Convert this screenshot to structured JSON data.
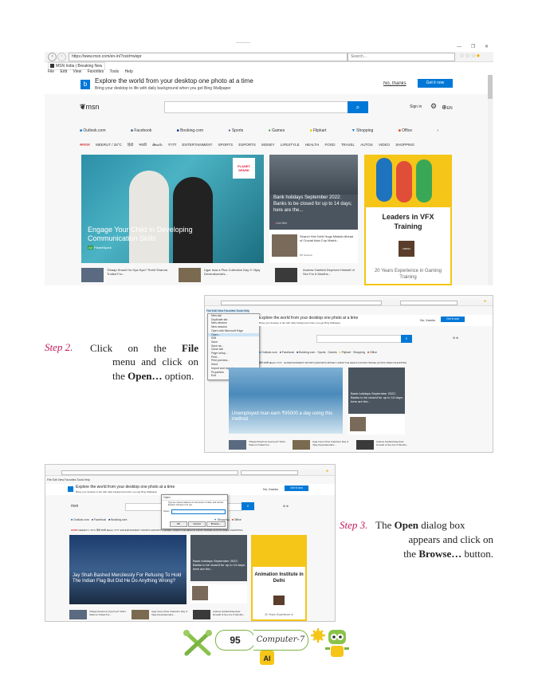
{
  "screenshot1": {
    "title_dash": "———",
    "window_controls": [
      "—",
      "❐",
      "✕"
    ],
    "url": "https://www.msn.com/en-in/?ocid=wispr",
    "search_placeholder": "Search...",
    "tab_title": "MSN India | Breaking News...",
    "menu": [
      "File",
      "Edit",
      "View",
      "Favorites",
      "Tools",
      "Help"
    ],
    "banner_title": "Explore the world from your desktop one photo at a time",
    "banner_sub": "Bring your desktop to life with daily background when you get Bing Wallpaper",
    "banner_no": "No, thanks",
    "banner_btn": "Get it now",
    "logo": "msn",
    "signin": "Sign in",
    "lang": "EN",
    "quicklinks": [
      "Outlook.com",
      "Facebook",
      "Booking.com",
      "Sports",
      "Games",
      "Flipkart",
      "Shopping",
      "Office"
    ],
    "categories": [
      "समाचार",
      "MEERUT / 25°C",
      "हिंदी",
      "मराठी",
      "తెలుగు",
      "বাংলা",
      "ENTERTAINMENT",
      "SPORTS",
      "ESPORTS",
      "MONEY",
      "LIFESTYLE",
      "HEALTH",
      "FOOD",
      "TRAVEL",
      "AUTOS",
      "VIDEO",
      "SHOPPING"
    ],
    "hero_title": "Engage Your Child in Developing Communication Skills",
    "hero_source": "PlanetSpark",
    "hero_badge": "PLANET SPARK",
    "news_title": "Bank holidays September 2022: Banks to be closed for up to 14 days; here are the...",
    "news_source": "Live Mint",
    "small_news": "Search Hrd Kohli Hugs Misbah Ahead of Crucial Asia Cup Match...",
    "small_news_source": "NP Network",
    "ad_title": "Leaders in VFX Training",
    "ad_sub": "20 Years Experience in Gaming Training",
    "ad_badge": "ARENA",
    "bottom_news": [
      "'Dhaap Khaoli Ho Gya Kya?' Rohit Sharma Trolled For...",
      "Ugar Issa a Plus Collection Day 9: Vijay Deverakonda's...",
      "Andrew Garfield Deprived Himself of Sex For 6 Months..."
    ]
  },
  "step2": {
    "label": "Step 2.",
    "line1_a": "Click",
    "line1_b": "on",
    "line1_c": "the",
    "line1_d": "File",
    "line2_a": "menu",
    "line2_b": "and",
    "line2_c": "click",
    "line2_d": "on",
    "line3_a": "the",
    "line3_b": "Open…",
    "line3_c": "option."
  },
  "screenshot2": {
    "file_menu": [
      "New tab",
      "Duplicate tab",
      "New window",
      "New session",
      "Open with Microsoft Edge",
      "Open...",
      "Edit",
      "Save",
      "Save as...",
      "Close tab",
      "Page setup...",
      "Print...",
      "Print preview...",
      "Send",
      "Import and export...",
      "Properties",
      "Exit"
    ],
    "hero_title": "Unemployed man earn ₹95000 a day using this method",
    "news_title": "Bank holidays September 2022: Banks to be closed for up to 14 days; here are the..."
  },
  "step3": {
    "label": "Step 3.",
    "line1_a": "The",
    "line1_b": "Open",
    "line1_c": "dialog box",
    "line2": "appears and click on",
    "line3_a": "the",
    "line3_b": "Browse…",
    "line3_c": "button."
  },
  "screenshot3": {
    "dialog_title": "Open",
    "dialog_text": "Type the Internet address of a document or folder, and Internet Explorer will open it for you.",
    "dialog_open_label": "Open:",
    "dialog_buttons": [
      "OK",
      "Cancel",
      "Browse..."
    ],
    "hero_title": "Jay Shah Bashed Mercilessly For Refusing To Hold The Indian Flag But Did He Do Anything Wrong?",
    "news_title": "Bank holidays September 2022: Banks to be closed for up to 14 days; here are the...",
    "ad_title": "Animation Institute in Delhi",
    "ad_sub": "20 Years Experience in"
  },
  "footer": {
    "page_number": "95",
    "book_title": "Computer-7",
    "ai_badge": "AI"
  }
}
